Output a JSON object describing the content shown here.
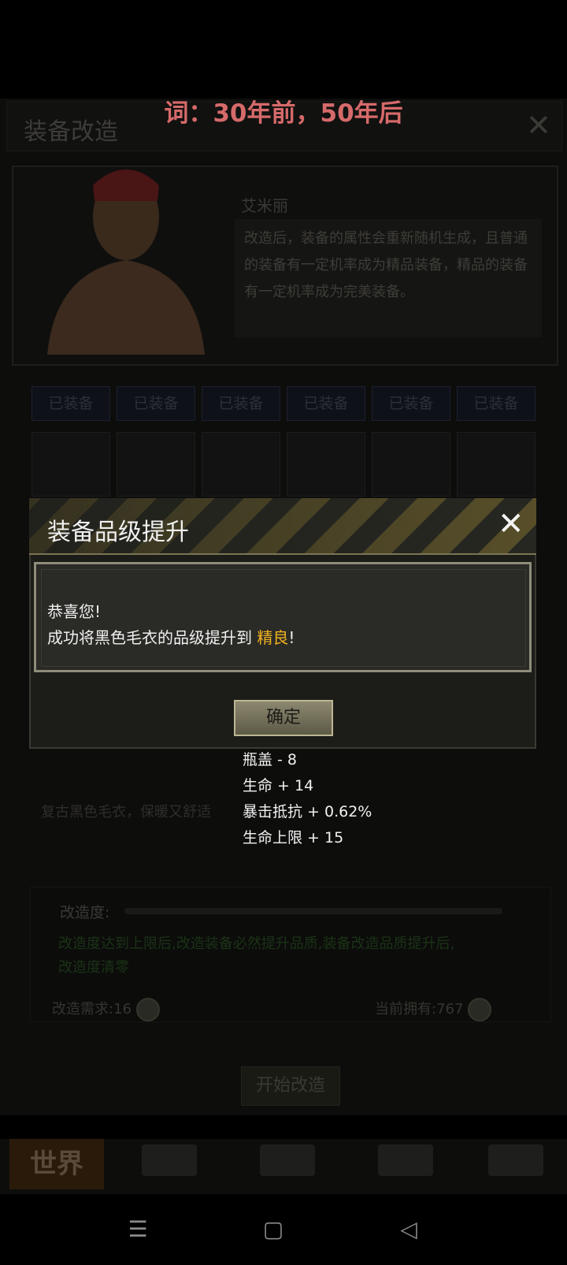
{
  "overlay_text": "词：30年前，50年后",
  "page": {
    "title": "装备改造",
    "npc_name": "艾米丽",
    "npc_description": "改造后，装备的属性会重新随机生成，且普通的装备有一定机率成为精品装备，精品的装备有一定机率成为完美装备。"
  },
  "equipment": {
    "tags": [
      "已装备",
      "已装备",
      "已装备",
      "已装备",
      "已装备",
      "已装备"
    ]
  },
  "item": {
    "description": "复古黑色毛衣，保暖又舒适",
    "stats": [
      "瓶盖 - 8",
      "生命 + 14",
      "暴击抵抗 + 0.62%",
      "生命上限 + 15"
    ]
  },
  "modify": {
    "label": "改造度:",
    "hint": "改造度达到上限后,改造装备必然提升品质,装备改造品质提升后,改造度清零",
    "requirement": "改造需求:16",
    "owned": "当前拥有:767",
    "start_button": "开始改造"
  },
  "nav": {
    "world": "世界"
  },
  "modal": {
    "title": "装备品级提升",
    "line1": "恭喜您!",
    "line2_prefix": "成功将黑色毛衣的品级提升到",
    "grade": "精良",
    "line2_suffix": "!",
    "ok_button": "确定"
  },
  "system_nav": {
    "menu_icon": "☰",
    "home_icon": "▢",
    "back_icon": "◁"
  }
}
